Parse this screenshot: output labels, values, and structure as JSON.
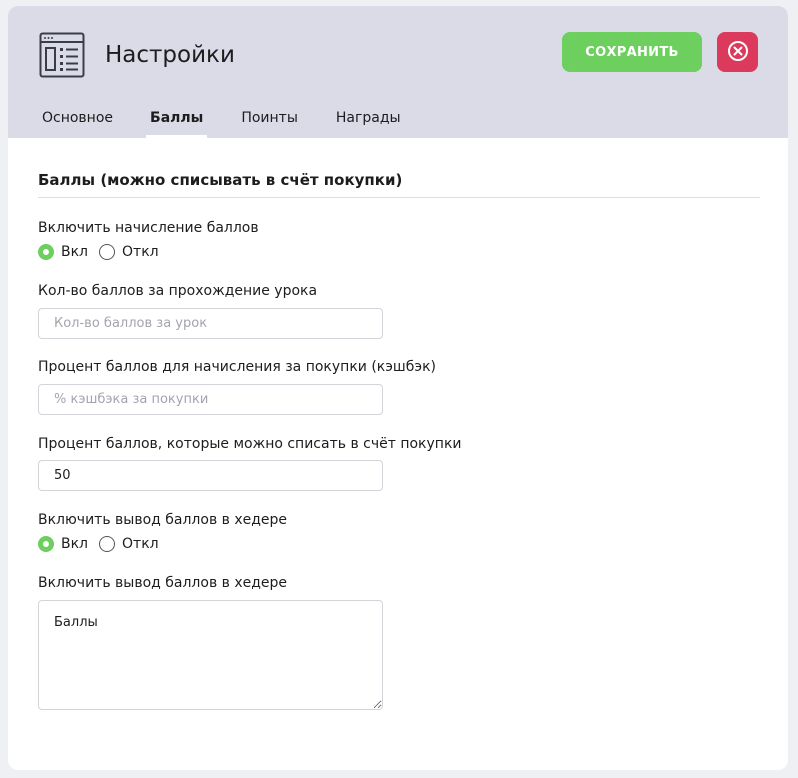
{
  "header": {
    "title": "Настройки",
    "app_icon": "settings-window-icon",
    "save_label": "СОХРАНИТЬ",
    "close_icon": "close-circle-icon"
  },
  "tabs": [
    {
      "label": "Основное",
      "active": false
    },
    {
      "label": "Баллы",
      "active": true
    },
    {
      "label": "Поинты",
      "active": false
    },
    {
      "label": "Награды",
      "active": false
    }
  ],
  "section": {
    "title": "Баллы (можно списывать в счёт покупки)"
  },
  "fields": {
    "enable_points": {
      "label": "Включить начисление баллов",
      "options": [
        "Вкл",
        "Откл"
      ],
      "selected": "Вкл"
    },
    "lesson_points": {
      "label": "Кол-во баллов за прохождение урока",
      "placeholder": "Кол-во баллов за урок",
      "value": ""
    },
    "cashback_percent": {
      "label": "Процент баллов для начисления за покупки (кэшбэк)",
      "placeholder": "% кэшбэка за покупки",
      "value": ""
    },
    "writeoff_percent": {
      "label": "Процент баллов, которые можно списать в счёт покупки",
      "placeholder": "",
      "value": "50"
    },
    "header_display": {
      "label": "Включить вывод баллов в хедере",
      "options": [
        "Вкл",
        "Откл"
      ],
      "selected": "Вкл"
    },
    "header_text": {
      "label": "Включить вывод баллов в хедере",
      "value": "Баллы"
    }
  },
  "colors": {
    "accent_green": "#6ccf5e",
    "close_red": "#dc3a5c",
    "header_bg": "#dadbe7"
  }
}
